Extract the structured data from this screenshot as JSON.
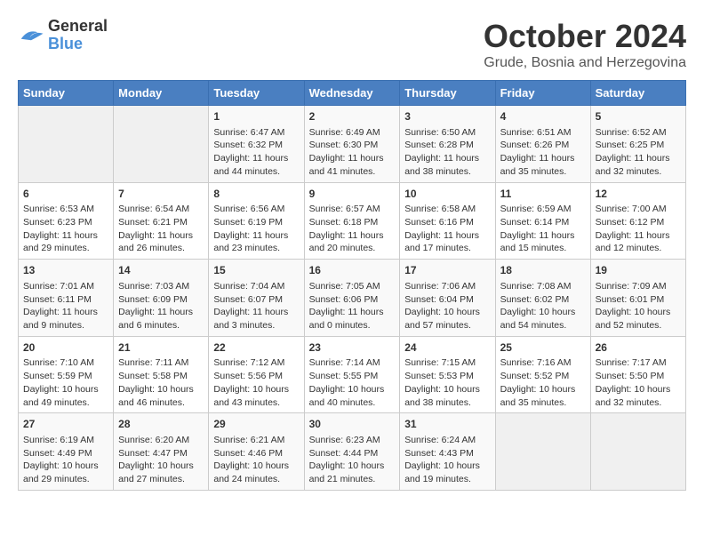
{
  "logo": {
    "line1": "General",
    "line2": "Blue"
  },
  "title": "October 2024",
  "subtitle": "Grude, Bosnia and Herzegovina",
  "days_of_week": [
    "Sunday",
    "Monday",
    "Tuesday",
    "Wednesday",
    "Thursday",
    "Friday",
    "Saturday"
  ],
  "weeks": [
    [
      {
        "day": "",
        "info": ""
      },
      {
        "day": "",
        "info": ""
      },
      {
        "day": "1",
        "info": "Sunrise: 6:47 AM\nSunset: 6:32 PM\nDaylight: 11 hours and 44 minutes."
      },
      {
        "day": "2",
        "info": "Sunrise: 6:49 AM\nSunset: 6:30 PM\nDaylight: 11 hours and 41 minutes."
      },
      {
        "day": "3",
        "info": "Sunrise: 6:50 AM\nSunset: 6:28 PM\nDaylight: 11 hours and 38 minutes."
      },
      {
        "day": "4",
        "info": "Sunrise: 6:51 AM\nSunset: 6:26 PM\nDaylight: 11 hours and 35 minutes."
      },
      {
        "day": "5",
        "info": "Sunrise: 6:52 AM\nSunset: 6:25 PM\nDaylight: 11 hours and 32 minutes."
      }
    ],
    [
      {
        "day": "6",
        "info": "Sunrise: 6:53 AM\nSunset: 6:23 PM\nDaylight: 11 hours and 29 minutes."
      },
      {
        "day": "7",
        "info": "Sunrise: 6:54 AM\nSunset: 6:21 PM\nDaylight: 11 hours and 26 minutes."
      },
      {
        "day": "8",
        "info": "Sunrise: 6:56 AM\nSunset: 6:19 PM\nDaylight: 11 hours and 23 minutes."
      },
      {
        "day": "9",
        "info": "Sunrise: 6:57 AM\nSunset: 6:18 PM\nDaylight: 11 hours and 20 minutes."
      },
      {
        "day": "10",
        "info": "Sunrise: 6:58 AM\nSunset: 6:16 PM\nDaylight: 11 hours and 17 minutes."
      },
      {
        "day": "11",
        "info": "Sunrise: 6:59 AM\nSunset: 6:14 PM\nDaylight: 11 hours and 15 minutes."
      },
      {
        "day": "12",
        "info": "Sunrise: 7:00 AM\nSunset: 6:12 PM\nDaylight: 11 hours and 12 minutes."
      }
    ],
    [
      {
        "day": "13",
        "info": "Sunrise: 7:01 AM\nSunset: 6:11 PM\nDaylight: 11 hours and 9 minutes."
      },
      {
        "day": "14",
        "info": "Sunrise: 7:03 AM\nSunset: 6:09 PM\nDaylight: 11 hours and 6 minutes."
      },
      {
        "day": "15",
        "info": "Sunrise: 7:04 AM\nSunset: 6:07 PM\nDaylight: 11 hours and 3 minutes."
      },
      {
        "day": "16",
        "info": "Sunrise: 7:05 AM\nSunset: 6:06 PM\nDaylight: 11 hours and 0 minutes."
      },
      {
        "day": "17",
        "info": "Sunrise: 7:06 AM\nSunset: 6:04 PM\nDaylight: 10 hours and 57 minutes."
      },
      {
        "day": "18",
        "info": "Sunrise: 7:08 AM\nSunset: 6:02 PM\nDaylight: 10 hours and 54 minutes."
      },
      {
        "day": "19",
        "info": "Sunrise: 7:09 AM\nSunset: 6:01 PM\nDaylight: 10 hours and 52 minutes."
      }
    ],
    [
      {
        "day": "20",
        "info": "Sunrise: 7:10 AM\nSunset: 5:59 PM\nDaylight: 10 hours and 49 minutes."
      },
      {
        "day": "21",
        "info": "Sunrise: 7:11 AM\nSunset: 5:58 PM\nDaylight: 10 hours and 46 minutes."
      },
      {
        "day": "22",
        "info": "Sunrise: 7:12 AM\nSunset: 5:56 PM\nDaylight: 10 hours and 43 minutes."
      },
      {
        "day": "23",
        "info": "Sunrise: 7:14 AM\nSunset: 5:55 PM\nDaylight: 10 hours and 40 minutes."
      },
      {
        "day": "24",
        "info": "Sunrise: 7:15 AM\nSunset: 5:53 PM\nDaylight: 10 hours and 38 minutes."
      },
      {
        "day": "25",
        "info": "Sunrise: 7:16 AM\nSunset: 5:52 PM\nDaylight: 10 hours and 35 minutes."
      },
      {
        "day": "26",
        "info": "Sunrise: 7:17 AM\nSunset: 5:50 PM\nDaylight: 10 hours and 32 minutes."
      }
    ],
    [
      {
        "day": "27",
        "info": "Sunrise: 6:19 AM\nSunset: 4:49 PM\nDaylight: 10 hours and 29 minutes."
      },
      {
        "day": "28",
        "info": "Sunrise: 6:20 AM\nSunset: 4:47 PM\nDaylight: 10 hours and 27 minutes."
      },
      {
        "day": "29",
        "info": "Sunrise: 6:21 AM\nSunset: 4:46 PM\nDaylight: 10 hours and 24 minutes."
      },
      {
        "day": "30",
        "info": "Sunrise: 6:23 AM\nSunset: 4:44 PM\nDaylight: 10 hours and 21 minutes."
      },
      {
        "day": "31",
        "info": "Sunrise: 6:24 AM\nSunset: 4:43 PM\nDaylight: 10 hours and 19 minutes."
      },
      {
        "day": "",
        "info": ""
      },
      {
        "day": "",
        "info": ""
      }
    ]
  ]
}
